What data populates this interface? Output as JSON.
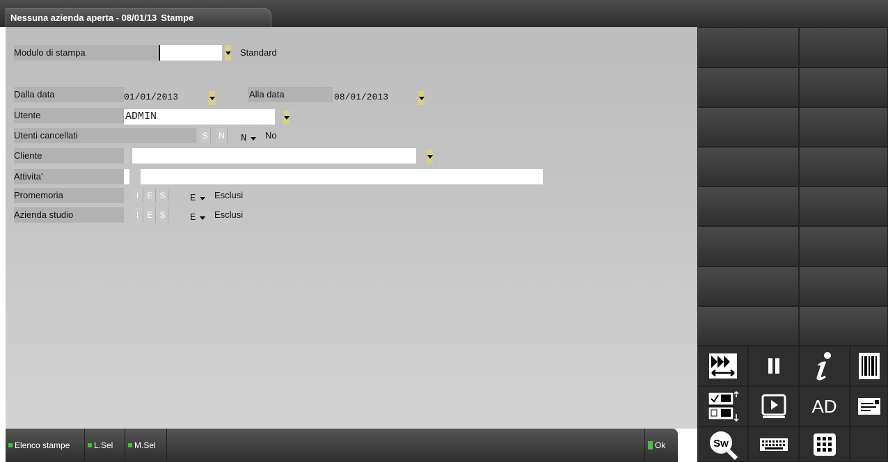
{
  "window": {
    "title": "Nessuna azienda aperta - 08/01/13",
    "tab": "Stampe"
  },
  "form": {
    "modulo_label": "Modulo di stampa",
    "modulo_value": "",
    "modulo_desc": "Standard",
    "dalla_label": "Dalla data",
    "dalla_value": "01/01/2013",
    "alla_label": "Alla data",
    "alla_value": "08/01/2013",
    "utente_label": "Utente",
    "utente_value": "ADMIN",
    "canc_label": "Utenti cancellati",
    "canc_opts": [
      "S",
      "N"
    ],
    "canc_value": "N",
    "canc_desc": "No",
    "cliente_label": "Cliente",
    "cliente_value": "",
    "attivita_label": "Attivita'",
    "attivita_value": "",
    "prom_label": "Promemoria",
    "prom_opts": [
      "I",
      "E",
      "S"
    ],
    "prom_value": "E",
    "prom_desc": "Esclusi",
    "az_label": "Azienda studio",
    "az_opts": [
      "I",
      "E",
      "S"
    ],
    "az_value": "E",
    "az_desc": "Esclusi"
  },
  "function_bar": {
    "elenco": "Elenco stampe",
    "lsel": "L.Sel",
    "msel": "M.Sel",
    "ok": "Ok"
  },
  "icons": {
    "ad_label": "AD",
    "sw_label": "Sw"
  },
  "colors": {
    "dropdown": "#d8d08a",
    "ok_green": "#44c044",
    "bar": "#2e2e2e"
  }
}
